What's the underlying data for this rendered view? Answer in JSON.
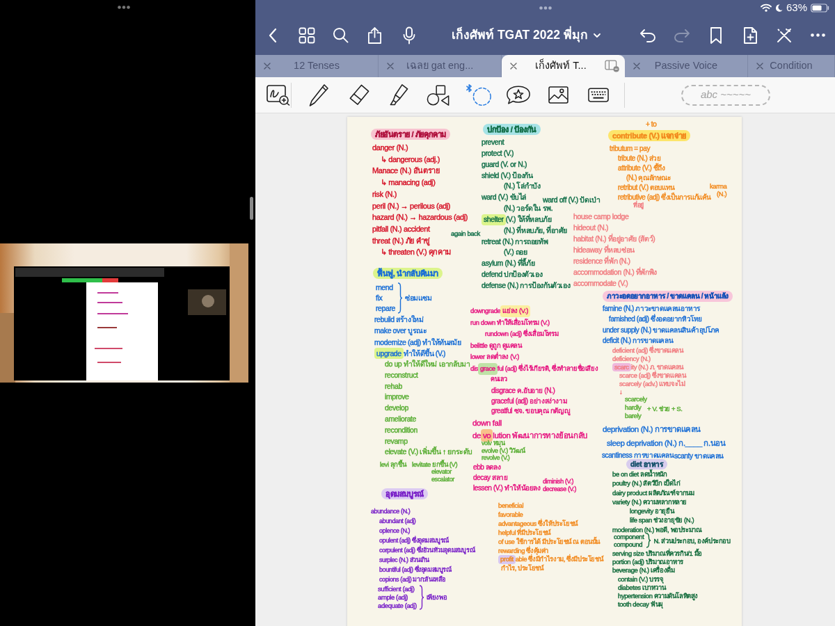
{
  "status_bar": {
    "battery": "63%"
  },
  "toolbar": {
    "title": "เก็งศัพท์ TGAT 2022 พี่มุก"
  },
  "history": [
    {
      "kind": "undo",
      "disabled": false
    },
    {
      "kind": "redo",
      "disabled": true
    }
  ],
  "tabs": [
    {
      "label": "12 Tenses",
      "selected": false
    },
    {
      "label": "เฉลย gat eng...",
      "selected": false
    },
    {
      "label": "เก็งศัพท์ T...",
      "selected": true
    },
    {
      "label": "Passive Voice",
      "selected": false
    },
    {
      "label": "Condition",
      "selected": false
    }
  ],
  "pen_preview": "abc ~~~~~",
  "page": {
    "blocks": [
      {
        "kind": "list",
        "color": "#d6152a",
        "heading": {
          "text": "ภัยอันตราย / ภัยคุกคาม",
          "color": "#b0123e",
          "highlight": {
            "color": "#f8c3d0"
          }
        },
        "lines": [
          {
            "text": "danger (N.)",
            "children": [
              {
                "text": "↳ dangerous (adj.)"
              }
            ]
          },
          {
            "text": "Manace (N.) อันตราย",
            "children": [
              {
                "text": "↳ manacing (adj)"
              }
            ]
          },
          {
            "text": "risk (N.)"
          },
          {
            "text": "peril (N.) → perilous (adj)"
          },
          {
            "text": "hazard (N.) → hazardous (adj)"
          },
          {
            "text": "pitfall (N.) accident"
          },
          {
            "text": "threat (N.) ภัย คำขู่",
            "children": [
              {
                "text": "↳ threaten (V.) คุกคาม"
              }
            ]
          }
        ]
      },
      {
        "kind": "list",
        "color": "#13704a",
        "lines": [
          {
            "text": "again back"
          }
        ]
      },
      {
        "kind": "brace",
        "color": "#1b6fd6",
        "heading": {
          "text": "ฟื้นฟู, นำกลับคืนมา",
          "highlight": {
            "color": "#dcf48c"
          }
        },
        "items": [
          "mend",
          "fix",
          "repare"
        ],
        "note": "ซ่อมแซม"
      },
      {
        "kind": "list",
        "color": "#1b6fd6",
        "lines": [
          {
            "text": "rebuild สร้างใหม่"
          },
          {
            "text": "make over บูรณะ"
          },
          {
            "text": "modernize (adj) ทำให้ทันสมัย"
          },
          {
            "parts": [
              {
                "text": "upgrade",
                "highlight": {
                  "color": "#dcf48c"
                }
              },
              {
                "text": "ทำให้ดีขึ้น (V.)"
              }
            ]
          }
        ]
      },
      {
        "kind": "list",
        "color": "#5aae35",
        "lines": [
          {
            "text": "do up ทำให้ดีใหม่ เอากลับมา"
          },
          {
            "text": "reconstruct"
          },
          {
            "text": "rehab"
          },
          {
            "text": "improve"
          },
          {
            "text": "develop"
          },
          {
            "text": "ameliorate"
          },
          {
            "text": "recondition"
          },
          {
            "text": "revamp"
          },
          {
            "text": "elevate (V.) เพิ่มขึ้น ↑ ยกระดับ"
          }
        ]
      },
      {
        "kind": "list",
        "color": "#5aae35",
        "lines": [
          {
            "text": "levi ลุกขึ้น"
          }
        ]
      },
      {
        "kind": "list",
        "color": "#5aae35",
        "lines": [
          {
            "text": "levitate ยกขึ้น (V)"
          }
        ]
      },
      {
        "kind": "list",
        "color": "#5aae35",
        "lines": [
          {
            "text": "elevator"
          },
          {
            "text": "escalator"
          }
        ]
      },
      {
        "kind": "list",
        "color": "#7a22c8",
        "heading": {
          "text": "อุดมสมบูรณ์",
          "highlight": {
            "color": "#dccbf2"
          }
        },
        "lines": [
          {
            "text": "abundance (N.)",
            "children": [
              {
                "text": "abundant (adj)"
              },
              {
                "text": "oplence (N.)"
              },
              {
                "text": "opulent (adj) ซึ่งอุดมสมบูรณ์"
              },
              {
                "text": "corpulent (adj) ซึ่งอ้วนท้วมอุดมสมบูรณ์"
              },
              {
                "text": "surplec (N.) ส่วนเกิน"
              },
              {
                "text": "bountiful (adj) ซึ่งอุดมสมบูรณ์"
              },
              {
                "text": "copions (adj) มาก:ล้นเหลือ"
              }
            ]
          }
        ]
      },
      {
        "kind": "brace",
        "color": "#7a22c8",
        "items": [
          "sufficient (adj)",
          "ample (adj)",
          "adequate (adj)"
        ],
        "note": "เพียงพอ"
      },
      {
        "kind": "list",
        "color": "#13704a",
        "heading": {
          "text": "ปกป้อง / ป้องกัน",
          "highlight": {
            "color": "#a7e3e6"
          }
        },
        "lines": [
          {
            "text": "prevent"
          },
          {
            "text": "protect (V.)"
          },
          {
            "text": "guard (V. or N.)"
          },
          {
            "text": "shield (V.) ป้องกัน",
            "children": [
              {
                "text": "(N.) โล่กำบัง"
              }
            ]
          },
          {
            "text": "ward (V.) ขับไล่",
            "children": [
              {
                "text": "(N.) วอร์ดใน รพ."
              }
            ]
          },
          {
            "parts": [
              {
                "text": "shelter",
                "highlight": {
                  "color": "#dcf48c"
                }
              },
              {
                "text": "(V.) ให้ที่หลบภัย"
              }
            ],
            "children": [
              {
                "text": "(N.) ที่หลบภัย, ที่อาศัย"
              }
            ]
          },
          {
            "text": "retreat (N.) การถอยทัพ",
            "children": [
              {
                "text": "(V.) ถอย"
              }
            ]
          },
          {
            "text": "asylum (N.) ที่ลี้ภัย"
          },
          {
            "text": "defend ปกป้องตัวเอง"
          },
          {
            "text": "defense (N.) การป้องกันตัวเอง"
          }
        ]
      },
      {
        "kind": "list",
        "color": "#13704a",
        "lines": [
          {
            "text": "ward off (V.) ปัดเป่า"
          }
        ]
      },
      {
        "kind": "list",
        "color": "#f28a1e",
        "lines": [
          {
            "text": "+ to"
          }
        ]
      },
      {
        "kind": "list",
        "color": "#f28a1e",
        "heading": {
          "text": "contribute (V.) แจกจ่าย",
          "highlight": {
            "color": "#fde56b"
          }
        },
        "lines": [
          {
            "text": "tributum = pay",
            "children": [
              {
                "text": "tribute (N.) ส่วย"
              },
              {
                "text": "attribute (V.) ชี้ถึง",
                "children": [
                  {
                    "text": "(N.) คุณลักษณะ"
                  }
                ]
              },
              {
                "text": "retribut (V.) ตอบแทน"
              },
              {
                "text": "retributive (adj) ซึ่งเป็นการแก้แค้น"
              }
            ]
          }
        ]
      },
      {
        "kind": "list",
        "color": "#f28a1e",
        "lines": [
          {
            "text": "karma",
            "children": [
              {
                "text": "(N.)"
              }
            ]
          }
        ]
      },
      {
        "kind": "list",
        "color": "#f17c80",
        "lines": [
          {
            "text": "ที่อยู่"
          }
        ]
      },
      {
        "kind": "list",
        "color": "#f17c80",
        "lines": [
          {
            "text": "house camp lodge"
          },
          {
            "text": "hideout (N.)"
          },
          {
            "text": "habitat (N.) ที่อยู่อาศัย (สัตว์)"
          },
          {
            "text": "hideaway ที่หลบซ่อน"
          },
          {
            "text": "residence ที่พัก (N.)"
          },
          {
            "text": "accommodation (N.) ที่พักพิง"
          },
          {
            "text": "accommodate (V.)"
          }
        ]
      },
      {
        "kind": "list",
        "color": "#e6127f",
        "lines": [
          {
            "parts": [
              {
                "text": "downgrade"
              },
              {
                "text": "แย่ลง (V.)",
                "highlight": {
                  "color": "#fbeea0"
                }
              }
            ]
          },
          {
            "text": "run down ทำให้เสื่อมโทรม (V.)",
            "children": [
              {
                "text": "rundown (adj) ซึ่งเสื่อมโทรม"
              }
            ]
          },
          {
            "text": "belittle ดูถูก ดูแคลน"
          },
          {
            "text": "lower ลดต่ำลง (V.)"
          },
          {
            "parts": [
              {
                "text": "dis"
              },
              {
                "text": "grace",
                "highlight": {
                  "color": "#bfe3a6"
                }
              },
              {
                "text": "ful (adj) ซึ่งไร้เกียรติ, ซึ่งทำลายชื่อเสียง"
              }
            ]
          }
        ]
      },
      {
        "kind": "list",
        "color": "#e6127f",
        "lines": [
          {
            "text": "คนเลว"
          }
        ]
      },
      {
        "kind": "list",
        "color": "#e6127f",
        "lines": [
          {
            "text": "disgrace ค.อับอาย (N.)"
          },
          {
            "text": "graceful (adj) อย่างสง่างาม"
          },
          {
            "text": "greatful ซจ. ขอบคุณ กตัญญู"
          }
        ]
      },
      {
        "kind": "list",
        "color": "#e6127f",
        "lines": [
          {
            "text": "down fall"
          },
          {
            "parts": [
              {
                "text": "de"
              },
              {
                "text": "vo",
                "highlight": {
                  "color": "#f9c08a"
                }
              },
              {
                "text": "lution พัฒนาการทางย้อนกลับ"
              }
            ]
          }
        ]
      },
      {
        "kind": "list",
        "color": "#5aae35",
        "lines": [
          {
            "text": "volv หมุน"
          },
          {
            "text": "evolve (V.) วิวัฒน์"
          },
          {
            "text": "revolve (V.)"
          }
        ]
      },
      {
        "kind": "list",
        "color": "#e6127f",
        "lines": [
          {
            "text": "ebb ลดลง"
          },
          {
            "text": "decay สลาย"
          },
          {
            "text": "lessen (V.) ทำให้น้อยลง"
          }
        ]
      },
      {
        "kind": "list",
        "color": "#e6127f",
        "lines": [
          {
            "text": "diminish (V.)"
          },
          {
            "text": "decrease (V.)"
          }
        ]
      },
      {
        "kind": "list",
        "color": "#f28a1e",
        "lines": [
          {
            "text": "beneficial"
          },
          {
            "text": "favorable"
          },
          {
            "text": "advantageous ซึ่งให้ประโยชน์"
          },
          {
            "text": "helpful ที่มีประโยชน์"
          },
          {
            "text": "of use ใช้การได้ มีประโยชน์ ณ ตอนนั้น"
          },
          {
            "text": "rewarding ซึ่งคุ้มค่า"
          },
          {
            "parts": [
              {
                "text": "profit",
                "highlight": {
                  "color": "#d9c8f0"
                }
              },
              {
                "text": "able ซึ่งมีกำไรงาม, ซึ่งมีประโยชน์"
              }
            ],
            "children": [
              {
                "text": "กำไร, ประโยชน์"
              }
            ]
          }
        ]
      },
      {
        "kind": "list",
        "color": "#1b6fd6",
        "heading": {
          "text": "ภาวะอดอยากอาหาร / ขาดแคลน / หน้าแล้ง",
          "color": "#1552b8",
          "highlight": {
            "color": "#f8c6da"
          }
        },
        "lines": [
          {
            "text": "famine (N.) ภาวะขาดแคลนอาหาร",
            "children": [
              {
                "text": "famished (adj) ซึ่งอดอยากหิวโหย"
              }
            ]
          },
          {
            "text": "under supply (N.) ขาดแคลนสินค้าอุปโภค"
          },
          {
            "text": "deficit (N.) การขาดแคลน"
          }
        ]
      },
      {
        "kind": "list",
        "color": "#f17c80",
        "lines": [
          {
            "text": "deficient (adj) ซึ่งขาดแคลน"
          },
          {
            "text": "deficiency (N.)"
          },
          {
            "parts": [
              {
                "text": "scarc",
                "highlight": {
                  "color": "#efb8dc"
                }
              },
              {
                "text": "ity (N.) ภ. ขาดแคลน"
              }
            ],
            "children": [
              {
                "text": "scarce (adj) ซึ่งขาดแคลน"
              },
              {
                "text": "scarcely (adv.) แทบจะไม่"
              },
              {
                "text": "↓"
              }
            ]
          }
        ]
      },
      {
        "kind": "list",
        "color": "#5aae35",
        "lines": [
          {
            "text": "scarcely"
          },
          {
            "text": "hardly"
          },
          {
            "text": "barely"
          }
        ]
      },
      {
        "kind": "list",
        "color": "#5aae35",
        "lines": [
          {
            "text": "+ V. ช่วย + S."
          }
        ]
      },
      {
        "kind": "list",
        "color": "#1b6fd6",
        "lines": [
          {
            "text": "deprivation (N.) การขาดแคลน",
            "children": [
              {
                "text": "sleep deprivation (N.) ก.____ ก.นอน"
              }
            ]
          }
        ]
      },
      {
        "kind": "list",
        "color": "#1b6fd6",
        "lines": [
          {
            "text": "scantiness การขาดแคลน"
          }
        ]
      },
      {
        "kind": "list",
        "color": "#1b6fd6",
        "lines": [
          {
            "text": "scanty ขาดแคลน"
          }
        ]
      },
      {
        "kind": "list",
        "color": "#136c3c",
        "heading": {
          "text": "diet อาหาร",
          "color": "#14506a",
          "highlight": {
            "color": "#d8cdee"
          }
        },
        "lines": [
          {
            "text": "be on diet ลดน้ำหนัก"
          },
          {
            "text": "poultry (N.) สัตว์ปีก เป็ดไก่"
          },
          {
            "text": "dairy product ผลิตภัณฑ์จากนม"
          },
          {
            "text": "variety (N.) ความหลากหลาย",
            "children": [
              {
                "text": "longevity อายุยืน"
              },
              {
                "text": "life span ช่วงอายุขัย (N.)"
              }
            ]
          },
          {
            "text": "moderation (N.) พอดี, พอประมาณ"
          }
        ]
      },
      {
        "kind": "brace",
        "color": "#136c3c",
        "items": [
          "component",
          "compound"
        ],
        "note": "N. ส่วนประกอบ, องค์ประกอบ"
      },
      {
        "kind": "list",
        "color": "#136c3c",
        "lines": [
          {
            "text": "serving size ปริมาณที่ควรกิน/1 มื้อ"
          },
          {
            "text": "portion (adj) ปริมาณอาหาร"
          },
          {
            "text": "beverage (N.) เครื่องดื่ม",
            "children": [
              {
                "text": "contain (V.) บรรจุ"
              },
              {
                "text": "diabetes เบาหวาน"
              },
              {
                "text": "hypertension ความดันโลหิตสูง"
              },
              {
                "text": "tooth decay ฟันผุ"
              }
            ]
          }
        ]
      }
    ]
  }
}
